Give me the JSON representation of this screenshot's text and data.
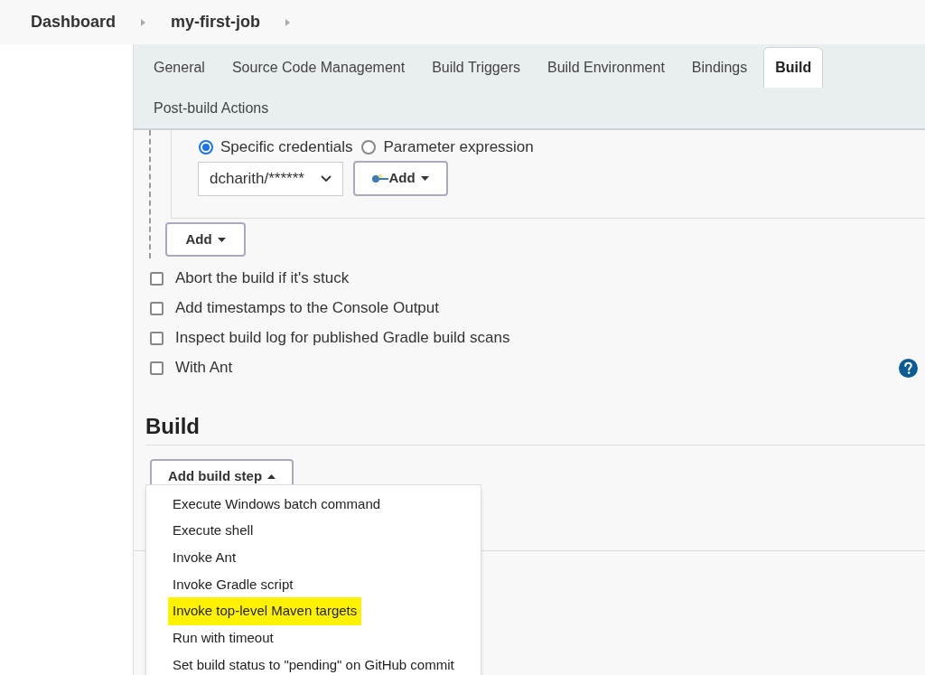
{
  "breadcrumbs": [
    {
      "label": "Dashboard"
    },
    {
      "label": "my-first-job"
    }
  ],
  "tabs": [
    {
      "label": "General",
      "selected": false
    },
    {
      "label": "Source Code Management",
      "selected": false
    },
    {
      "label": "Build Triggers",
      "selected": false
    },
    {
      "label": "Build Environment",
      "selected": false
    },
    {
      "label": "Bindings",
      "selected": false
    },
    {
      "label": "Build",
      "selected": true
    },
    {
      "label": "Post-build Actions",
      "selected": false
    }
  ],
  "credentials": {
    "radios": [
      {
        "label": "Specific credentials",
        "selected": true
      },
      {
        "label": "Parameter expression",
        "selected": false
      }
    ],
    "select_value": "dcharith/******",
    "add_button": "Add"
  },
  "add_button": "Add",
  "options": [
    {
      "label": "Abort the build if it's stuck",
      "checked": false
    },
    {
      "label": "Add timestamps to the Console Output",
      "checked": false
    },
    {
      "label": "Inspect build log for published Gradle build scans",
      "checked": false
    },
    {
      "label": "With Ant",
      "checked": false
    }
  ],
  "build_section": {
    "title": "Build",
    "add_step_button": "Add build step",
    "menu": [
      {
        "label": "Execute Windows batch command",
        "highlighted": false
      },
      {
        "label": "Execute shell",
        "highlighted": false
      },
      {
        "label": "Invoke Ant",
        "highlighted": false
      },
      {
        "label": "Invoke Gradle script",
        "highlighted": false
      },
      {
        "label": "Invoke top-level Maven targets",
        "highlighted": true
      },
      {
        "label": "Run with timeout",
        "highlighted": false
      },
      {
        "label": "Set build status to \"pending\" on GitHub commit",
        "highlighted": false
      }
    ]
  }
}
